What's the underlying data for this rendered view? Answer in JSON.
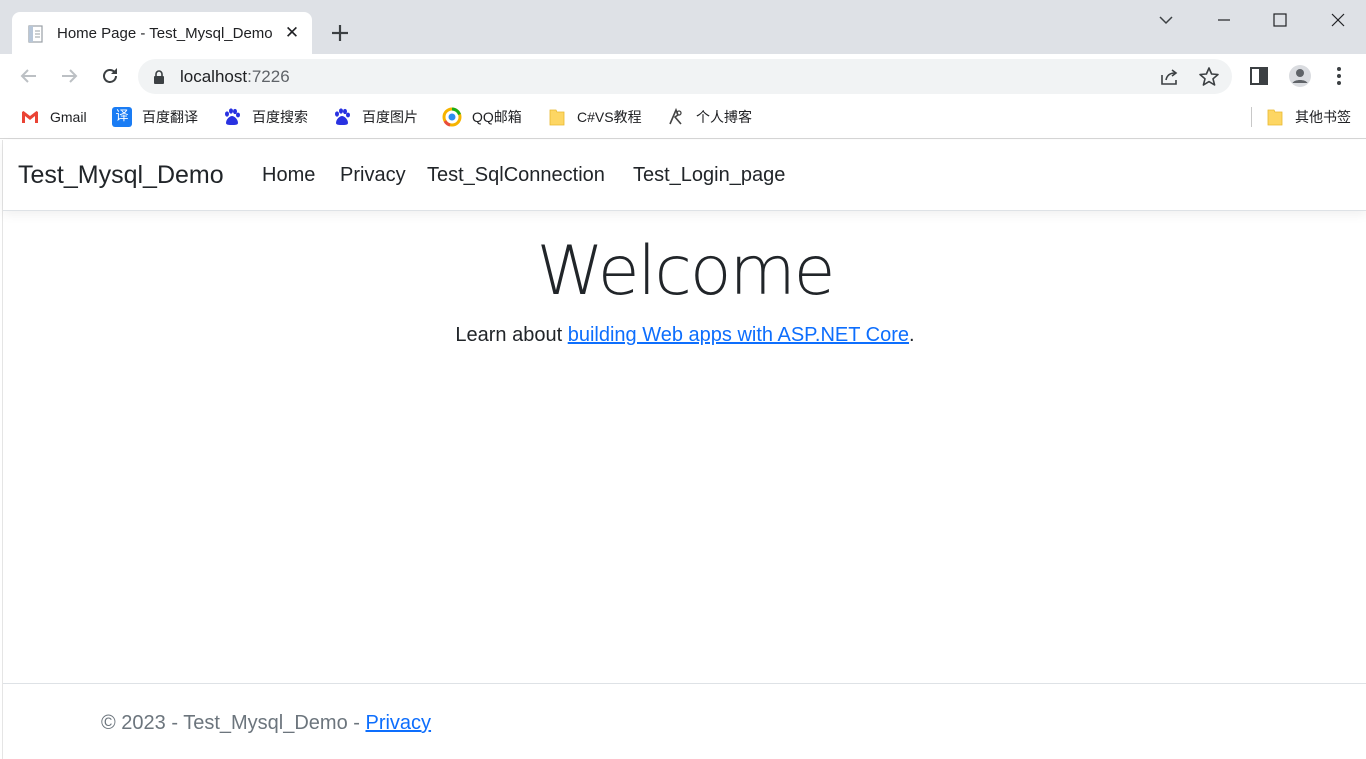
{
  "browser": {
    "tab": {
      "title": "Home Page - Test_Mysql_Demo",
      "close_glyph": "✕",
      "favicon": "page-icon"
    },
    "new_tab_glyph": "+",
    "address": {
      "host": "localhost",
      "port": ":7226"
    },
    "bookmarks": [
      {
        "label": "Gmail",
        "icon": "gmail-icon"
      },
      {
        "label": "百度翻译",
        "icon": "translate-icon",
        "icon_text": "译"
      },
      {
        "label": "百度搜索",
        "icon": "baidu-icon"
      },
      {
        "label": "百度图片",
        "icon": "baidu-icon"
      },
      {
        "label": "QQ邮箱",
        "icon": "qq-mail-icon"
      },
      {
        "label": "C#VS教程",
        "icon": "folder-icon"
      },
      {
        "label": "个人搏客",
        "icon": "blog-icon"
      }
    ],
    "other_bookmarks": "其他书签"
  },
  "navbar": {
    "brand": "Test_Mysql_Demo",
    "links": [
      "Home",
      "Privacy",
      "Test_SqlConnection",
      "Test_Login_page"
    ]
  },
  "main": {
    "heading": "Welcome",
    "learn_prefix": "Learn about ",
    "learn_link": "building Web apps with ASP.NET Core",
    "learn_suffix": "."
  },
  "footer": {
    "text": "© 2023 - Test_Mysql_Demo - ",
    "privacy_link": "Privacy"
  },
  "colors": {
    "link": "#0d6efd",
    "text": "#212529",
    "muted": "#6c757d",
    "chrome_frame": "#dee1e6"
  }
}
